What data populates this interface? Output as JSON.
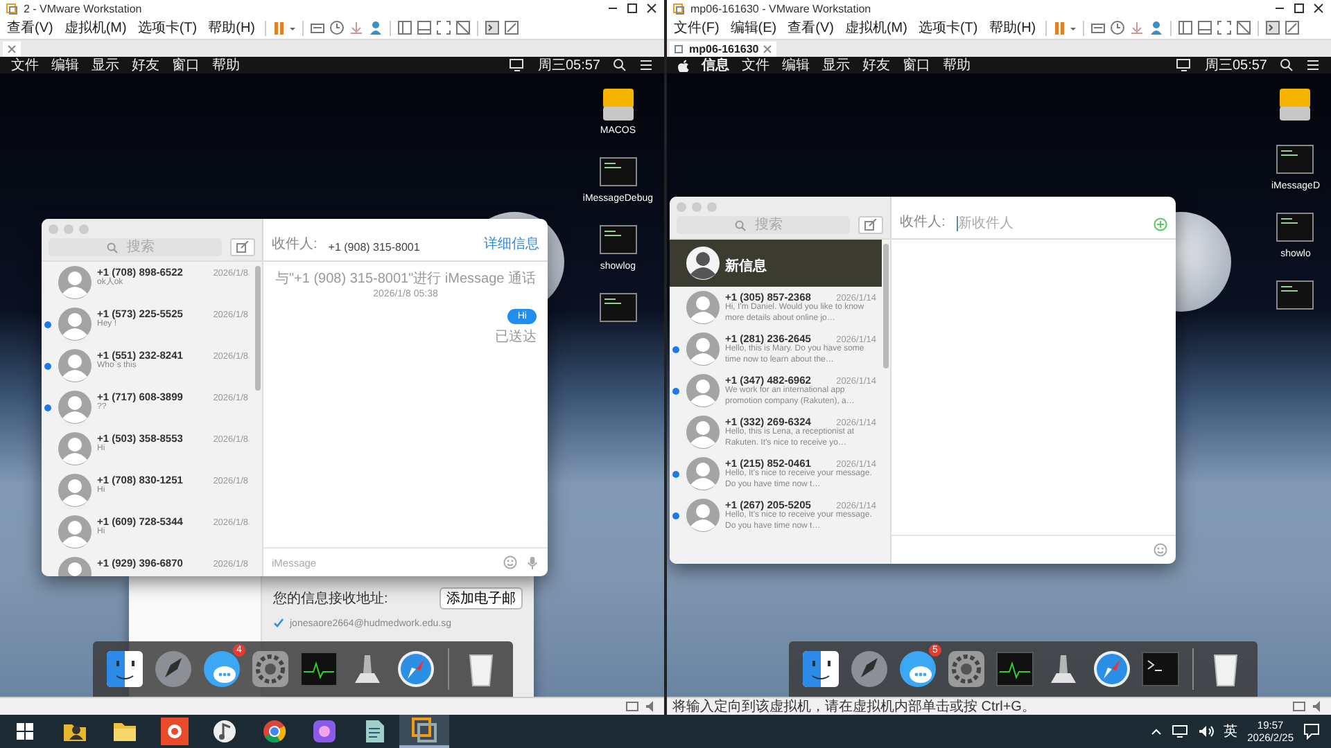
{
  "vm_windows": [
    {
      "title": "2 - VMware Workstation",
      "menu": [
        "查看(V)",
        "虚拟机(M)",
        "选项卡(T)",
        "帮助(H)"
      ],
      "guest": {
        "apple_logo": false,
        "menubar": [
          "文件",
          "编辑",
          "显示",
          "好友",
          "窗口",
          "帮助"
        ],
        "clock": "周三05:57",
        "desktop_icons": [
          {
            "kind": "drive",
            "label": "MACOS"
          },
          {
            "kind": "script",
            "label": "iMessageDebug"
          },
          {
            "kind": "script",
            "label": "showlog"
          },
          {
            "kind": "script"
          }
        ],
        "prefs": {
          "label": "您的信息接收地址:",
          "button": "添加电子邮",
          "addresses": [
            {
              "text": "jonesaore2664@hudmedwork.edu.sg",
              "checked": true
            }
          ]
        },
        "messages": {
          "search_placeholder": "搜索",
          "recipient_label": "收件人:",
          "recipient": "+1 (908) 315-8001",
          "details_link": "详细信息",
          "conversations": [
            {
              "kind": "contact",
              "name": "+1 (708) 898-6522",
              "date": "2026/1/8",
              "preview": "ok人ok",
              "unread": false,
              "selected": false
            },
            {
              "kind": "contact",
              "name": "+1 (573) 225-5525",
              "date": "2026/1/8",
              "preview": "Hey !",
              "unread": true,
              "selected": false
            },
            {
              "kind": "contact",
              "name": "+1 (551) 232-8241",
              "date": "2026/1/8",
              "preview": "Who`s this",
              "unread": true,
              "selected": false
            },
            {
              "kind": "contact",
              "name": "+1 (717) 608-3899",
              "date": "2026/1/8",
              "preview": "??",
              "unread": true,
              "selected": false
            },
            {
              "kind": "contact",
              "name": "+1 (503) 358-8553",
              "date": "2026/1/8",
              "preview": "Hi",
              "unread": false,
              "selected": false
            },
            {
              "kind": "contact",
              "name": "+1 (708) 830-1251",
              "date": "2026/1/8",
              "preview": "Hi",
              "unread": false,
              "selected": false
            },
            {
              "kind": "contact",
              "name": "+1 (609) 728-5344",
              "date": "2026/1/8",
              "preview": "Hi",
              "unread": false,
              "selected": false
            },
            {
              "kind": "contact",
              "name": "+1 (929) 396-6870",
              "date": "2026/1/8",
              "unread": false,
              "selected": false
            }
          ],
          "chat": {
            "notice": "与\"+1 (908) 315-8001\"进行 iMessage 通话",
            "timestamp": "2026/1/8 05:38",
            "messages": [
              {
                "text": "Hi",
                "status": "已送达"
              }
            ]
          },
          "input": {
            "placeholder": "iMessage",
            "icons": [
              {
                "kind": "emoji"
              },
              {
                "kind": "mic"
              }
            ]
          }
        },
        "dock": [
          {
            "kind": "finder"
          },
          {
            "kind": "rocket"
          },
          {
            "kind": "chat",
            "badge": "4"
          },
          {
            "kind": "gear"
          },
          {
            "kind": "monitor"
          },
          {
            "kind": "pedestal"
          },
          {
            "kind": "compass"
          },
          {
            "kind": "trash"
          }
        ]
      }
    },
    {
      "title": "mp06-161630 - VMware Workstation",
      "menu": [
        "文件(F)",
        "编辑(E)",
        "查看(V)",
        "虚拟机(M)",
        "选项卡(T)",
        "帮助(H)"
      ],
      "tab": {
        "label": "mp06-161630"
      },
      "guest": {
        "apple_logo": true,
        "menubar": [
          "信息",
          "文件",
          "编辑",
          "显示",
          "好友",
          "窗口",
          "帮助"
        ],
        "clock": "周三05:57",
        "desktop_icons": [
          {
            "kind": "drive"
          },
          {
            "kind": "script",
            "label": "iMessageD"
          },
          {
            "kind": "script",
            "label": "showlo"
          },
          {
            "kind": "script"
          }
        ],
        "messages": {
          "search_placeholder": "搜索",
          "recipient_label": "收件人:",
          "recipient_placeholder": "新收件人",
          "add_button": true,
          "conversations": [
            {
              "kind": "draft",
              "name": "新信息",
              "unread": false,
              "selected": true
            },
            {
              "kind": "contact",
              "name": "+1 (305) 857-2368",
              "date": "2026/1/14",
              "preview": "Hi, I'm Daniel. Would you like to know more details about online jo…",
              "unread": false,
              "selected": false
            },
            {
              "kind": "contact",
              "name": "+1 (281) 236-2645",
              "date": "2026/1/14",
              "preview": "Hello, this is Mary. Do you have some time now to learn about the…",
              "unread": true,
              "selected": false
            },
            {
              "kind": "contact",
              "name": "+1 (347) 482-6962",
              "date": "2026/1/14",
              "preview": "We work for an international app promotion company (Rakuten), a…",
              "unread": true,
              "selected": false
            },
            {
              "kind": "contact",
              "name": "+1 (332) 269-6324",
              "date": "2026/1/14",
              "preview": "Hello, this is Lena, a receptionist at Rakuten. It's nice to receive yo…",
              "unread": false,
              "selected": false
            },
            {
              "kind": "contact",
              "name": "+1 (215) 852-0461",
              "date": "2026/1/14",
              "preview": "Hello, It's nice to receive your message. Do you have time now t…",
              "unread": true,
              "selected": false
            },
            {
              "kind": "contact",
              "name": "+1 (267) 205-5205",
              "date": "2026/1/14",
              "preview": "Hello, It's nice to receive your message. Do you have time now t…",
              "unread": true,
              "selected": false
            }
          ],
          "input": {
            "icons": [
              {
                "kind": "emoji"
              }
            ]
          }
        },
        "dock": [
          {
            "kind": "finder"
          },
          {
            "kind": "rocket"
          },
          {
            "kind": "chat",
            "badge": "5"
          },
          {
            "kind": "gear"
          },
          {
            "kind": "monitor"
          },
          {
            "kind": "pedestal"
          },
          {
            "kind": "compass"
          },
          {
            "kind": "terminal"
          },
          {
            "kind": "trash"
          }
        ]
      },
      "status": "将输入定向到该虚拟机，请在虚拟机内部单击或按 Ctrl+G。"
    }
  ],
  "taskbar": {
    "apps": [
      {
        "kind": "user-folder",
        "active": false
      },
      {
        "kind": "folder",
        "active": false
      },
      {
        "kind": "recorder",
        "active": false
      },
      {
        "kind": "music",
        "active": false
      },
      {
        "kind": "browser",
        "active": false
      },
      {
        "kind": "tile",
        "active": false
      },
      {
        "kind": "document",
        "active": false
      },
      {
        "kind": "vm",
        "active": true
      }
    ],
    "ime": "英",
    "time": "19:57",
    "date": "2026/2/25"
  }
}
